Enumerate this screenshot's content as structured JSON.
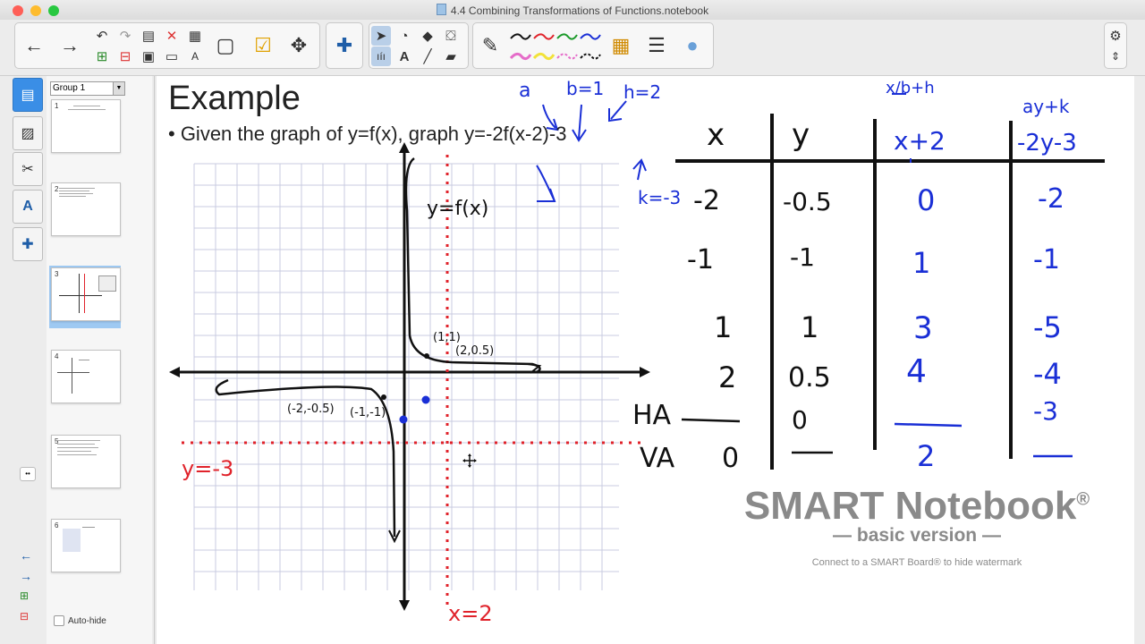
{
  "window": {
    "title": "4.4 Combining Transformations of Functions.notebook",
    "traffic_lights": [
      "#fe5f57",
      "#febc2e",
      "#28c840"
    ]
  },
  "sidebar": {
    "group_label": "Group 1",
    "pages": [
      "1",
      "2",
      "3",
      "4",
      "5",
      "6"
    ],
    "selected_page": "3",
    "autohide_label": "Auto-hide"
  },
  "slide": {
    "title": "Example",
    "bullet": "• Given the graph of y=f(x), graph y=-2f(x-2)-3"
  },
  "annotations": {
    "a": "a",
    "b": "b=1",
    "h": "h=2",
    "k": "k=-3",
    "graph_label": "y=f(x)",
    "point_1": "(1,1)",
    "point_2": "(2,0.5)",
    "point_3": "(-2,-0.5)",
    "point_4": "(-1,-1)",
    "ha_line_label": "y=-3",
    "va_line_label": "x=2",
    "col_x_formula_top": "x/b+h",
    "col_y_formula_top": "ay+k"
  },
  "table": {
    "headers": [
      "x",
      "y",
      "x+2",
      "-2y-3"
    ],
    "rows": [
      [
        "-2",
        "-0.5",
        "0",
        "-2"
      ],
      [
        "-1",
        "-1",
        "1",
        "-1"
      ],
      [
        "1",
        "1",
        "3",
        "-5"
      ],
      [
        "2",
        "0.5",
        "4",
        "-4"
      ]
    ],
    "ha_label": "HA",
    "ha_row": [
      "",
      "0",
      "",
      "-3"
    ],
    "va_label": "VA",
    "va_row": [
      "0",
      "",
      "2",
      ""
    ]
  },
  "watermark": {
    "title": "SMART Notebook",
    "reg": "®",
    "edition": "— basic version —",
    "note": "Connect to a SMART Board® to hide watermark"
  },
  "colors": {
    "ink_black": "#111111",
    "ink_blue": "#1a2fd6",
    "ink_red": "#e0232b",
    "selected_tab": "#3a8ee6"
  }
}
